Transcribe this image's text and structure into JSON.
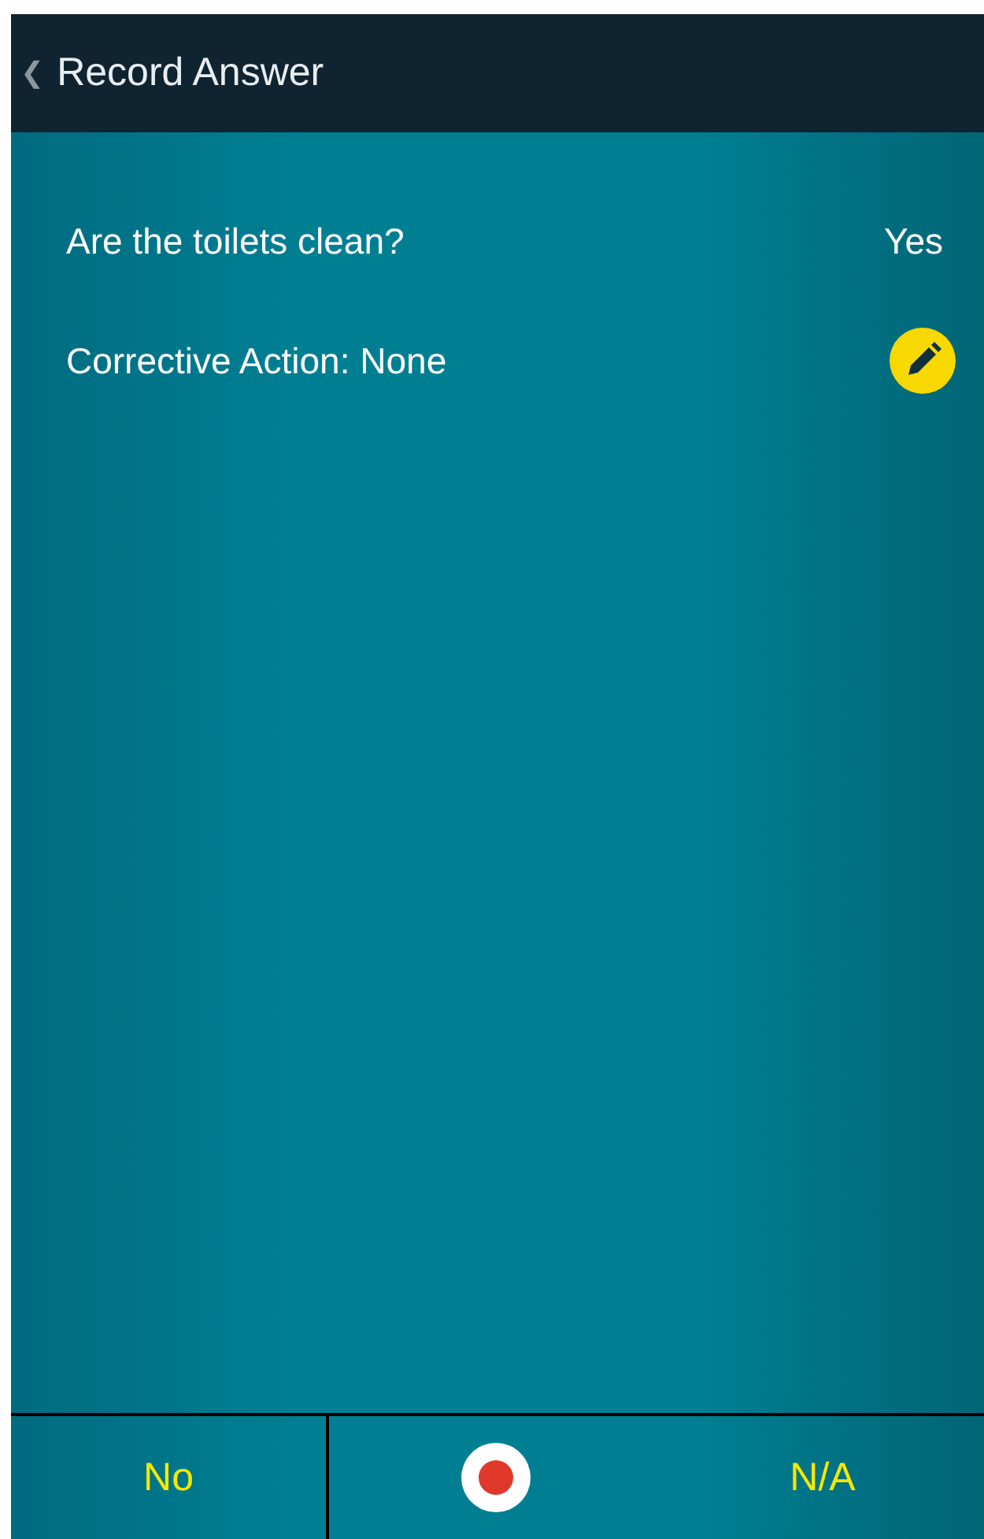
{
  "header": {
    "back_icon": "❮",
    "title": "Record Answer"
  },
  "rows": [
    {
      "kind": "answer",
      "label": "Are the toilets clean?",
      "value": "Yes"
    },
    {
      "kind": "edit",
      "label": "Corrective Action: None"
    }
  ],
  "bottom_bar": [
    {
      "kind": "text",
      "label": "No"
    },
    {
      "kind": "record"
    },
    {
      "kind": "text",
      "label": "N/A"
    }
  ]
}
